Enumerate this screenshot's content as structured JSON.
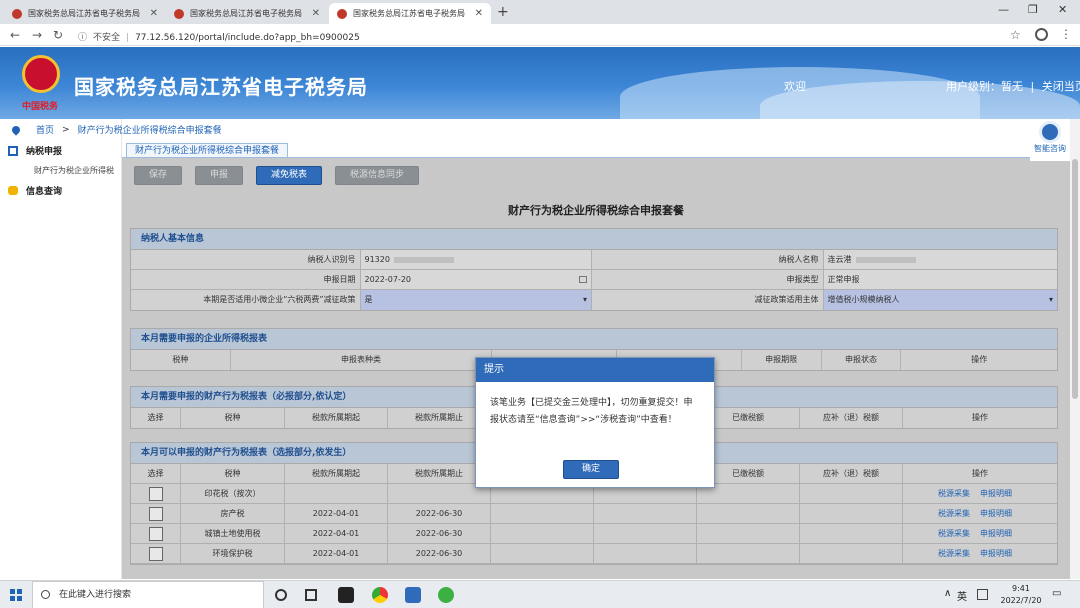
{
  "browser": {
    "tabs": [
      {
        "title": "国家税务总局江苏省电子税务局",
        "active": false
      },
      {
        "title": "国家税务总局江苏省电子税务局",
        "active": false
      },
      {
        "title": "国家税务总局江苏省电子税务局",
        "active": true
      }
    ],
    "new_tab": "+",
    "address": {
      "security": "不安全",
      "url": "77.12.56.120/portal/include.do?app_bh=0900025"
    },
    "window_controls": {
      "minimize": "—",
      "maximize": "❐",
      "close": "✕"
    }
  },
  "site": {
    "emblem_text": "中国税务",
    "title": "国家税务总局江苏省电子税务局",
    "welcome": "欢迎",
    "user_level": "用户级别：暂无",
    "separator": "|",
    "close_page": "关闭当页"
  },
  "breadcrumb": {
    "home": "首页",
    "sep": ">",
    "current": "财产行为税企业所得税综合申报套餐"
  },
  "sidebar": {
    "items": [
      {
        "label": "纳税申报",
        "icon": "grid-icon"
      },
      {
        "label": "财产行为税企业所得税",
        "icon": null,
        "sub": true
      },
      {
        "label": "信息查询",
        "icon": "chat-icon"
      }
    ]
  },
  "content": {
    "tab_label": "财产行为税企业所得税综合申报套餐",
    "buttons": [
      {
        "label": "保存",
        "state": "disabled"
      },
      {
        "label": "申报",
        "state": "disabled"
      },
      {
        "label": "减免税表",
        "state": "primary"
      },
      {
        "label": "税源信息同步",
        "state": "disabled"
      }
    ],
    "page_title": "财产行为税企业所得税综合申报套餐",
    "basic_info": {
      "heading": "纳税人基本信息",
      "taxpayer_id_label": "纳税人识别号",
      "taxpayer_id_value": "91320",
      "taxpayer_name_label": "纳税人名称",
      "taxpayer_name_value": "连云港",
      "declare_date_label": "申报日期",
      "declare_date_value": "2022-07-20",
      "declare_type_label": "申报类型",
      "declare_type_value": "正常申报",
      "policy_label": "本期是否适用小微企业“六税两费”减征政策",
      "policy_value": "是",
      "subject_label": "减征政策适用主体",
      "subject_value": "增值税小规模纳税人"
    },
    "sec2": {
      "heading": "本月需要申报的企业所得税报表",
      "columns": [
        "税种",
        "申报表种类",
        "",
        "",
        "申报期限",
        "申报状态",
        "操作"
      ]
    },
    "sec3": {
      "heading": "本月需要申报的财产行为税报表（必报部分,依认定）",
      "columns": [
        "选择",
        "税种",
        "税款所属期起",
        "税款所属期止",
        "",
        "",
        "已缴税额",
        "应补（退）税额",
        "操作"
      ]
    },
    "sec4": {
      "heading": "本月可以申报的财产行为税报表（选报部分,依发生）",
      "columns": [
        "选择",
        "税种",
        "税款所属期起",
        "税款所属期止",
        "",
        "",
        "已缴税额",
        "应补（退）税额",
        "操作"
      ],
      "rows": [
        {
          "tax": "印花税（按次）",
          "start": "",
          "end": ""
        },
        {
          "tax": "房产税",
          "start": "2022-04-01",
          "end": "2022-06-30"
        },
        {
          "tax": "城镇土地使用税",
          "start": "2022-04-01",
          "end": "2022-06-30"
        },
        {
          "tax": "环境保护税",
          "start": "2022-04-01",
          "end": "2022-06-30"
        }
      ],
      "action_collect": "税源采集",
      "action_detail": "申报明细"
    }
  },
  "modal": {
    "title": "提示",
    "message": "该笔业务【已提交金三处理中】，切勿重复提交！申报状态请至“信息查询”>>“涉税查询”中查看！",
    "ok": "确定"
  },
  "assistant": {
    "label": "智能咨询"
  },
  "taskbar": {
    "search_placeholder": "在此键入进行搜索",
    "ime": "英",
    "time": "9:41",
    "date": "2022/7/20"
  }
}
